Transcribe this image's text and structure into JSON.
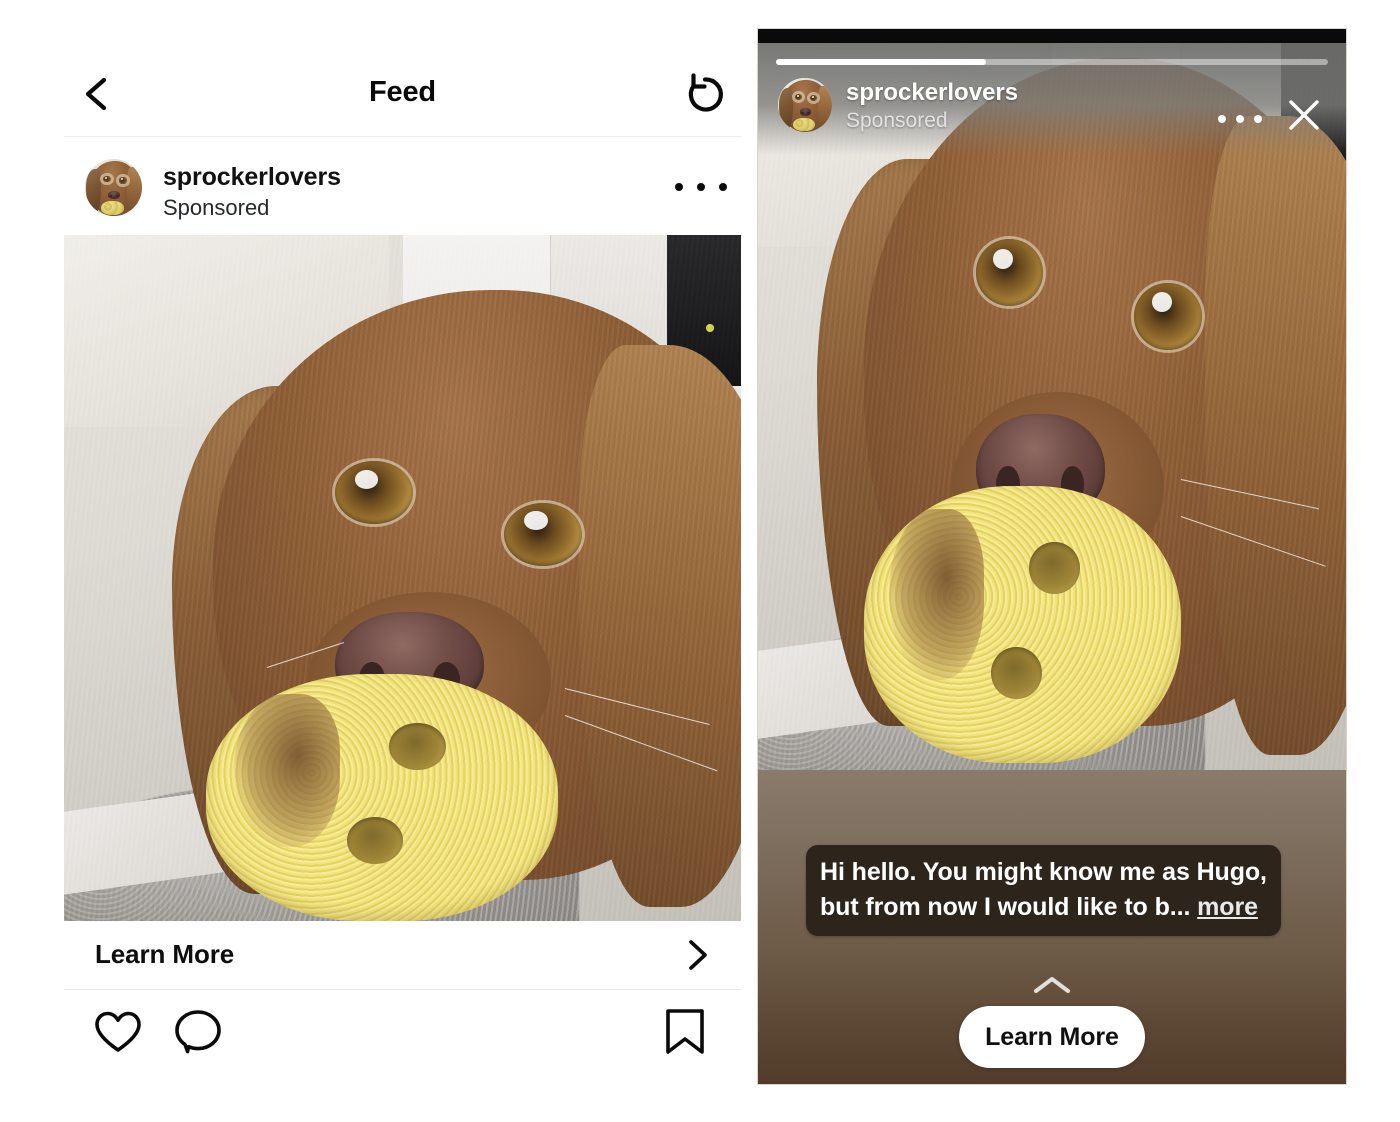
{
  "feed": {
    "back_icon": "chevron-left-icon",
    "title": "Feed",
    "refresh_icon": "refresh-counterclockwise-icon",
    "post": {
      "username": "sprockerlovers",
      "sponsored_label": "Sponsored",
      "more_icon": "ellipsis-icon",
      "avatar_alt": "sprockerlovers-avatar",
      "photo_alt": "brown-sprocker-spaniel-holding-yellow-sponge-toy",
      "cta_label": "Learn More",
      "cta_chevron_icon": "chevron-right-icon",
      "actions": {
        "like_icon": "heart-icon",
        "comment_icon": "comment-bubble-icon",
        "save_icon": "bookmark-icon"
      }
    }
  },
  "story": {
    "username": "sprockerlovers",
    "sponsored_label": "Sponsored",
    "more_icon": "ellipsis-icon",
    "close_icon": "close-x-icon",
    "avatar_alt": "sprockerlovers-avatar",
    "photo_alt": "brown-sprocker-spaniel-holding-yellow-sponge-toy",
    "progress_percent": 38,
    "caption_line_1": "Hi hello. You might know me as Hugo,",
    "caption_line_2": "but from now I would like to b...",
    "caption_more_label": "more",
    "swipe_up_icon": "chevron-up-icon",
    "cta_label": "Learn More"
  },
  "colors": {
    "page_background": "#ffffff",
    "primary_text": "#0a0a0a",
    "secondary_text": "#25292c",
    "divider": "#eceef0",
    "story_black_bar": "#0a0a0a",
    "story_scrim": "#6e6e6c",
    "story_footer_top": "#8b7b6c",
    "story_footer_bottom": "#513c2b",
    "caption_bubble": "#2d241c",
    "cta_button_background": "#ffffff",
    "progress_fill": "#ffffff",
    "progress_track": "rgba(255,255,255,0.45)"
  }
}
